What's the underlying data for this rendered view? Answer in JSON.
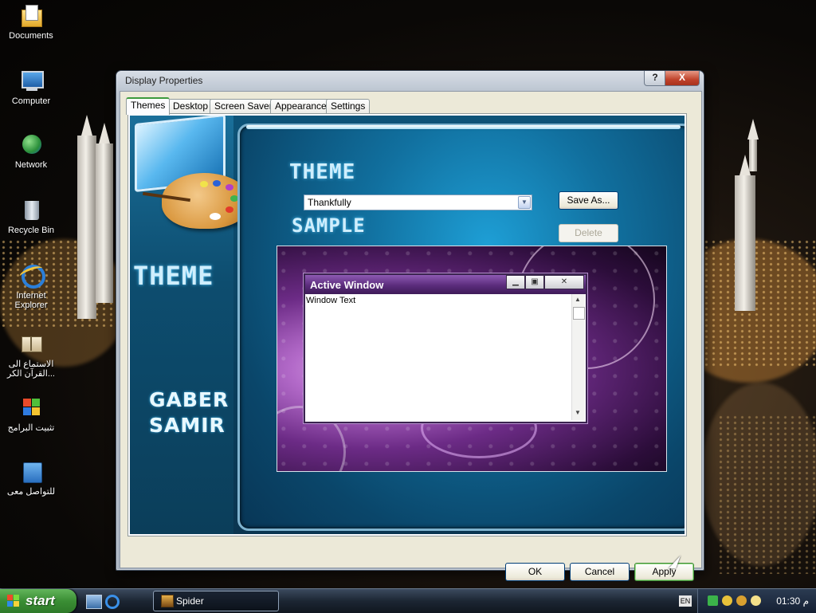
{
  "desktop": {
    "icons": [
      {
        "label": "Documents"
      },
      {
        "label": "Computer"
      },
      {
        "label": "Network"
      },
      {
        "label": "Recycle Bin"
      },
      {
        "label": "Internet Explorer"
      },
      {
        "label": "الاستماع الى القرآن الكر..."
      },
      {
        "label": "تثبيت البرامج"
      },
      {
        "label": "للتواصل معى"
      }
    ]
  },
  "dialog": {
    "title": "Display Properties",
    "help_label": "?",
    "close_label": "X",
    "tabs": [
      {
        "label": "Themes"
      },
      {
        "label": "Desktop"
      },
      {
        "label": "Screen Saver"
      },
      {
        "label": "Appearance"
      },
      {
        "label": "Settings"
      }
    ],
    "skin_text": {
      "theme_header": "THEME",
      "sample_header": "SAMPLE",
      "left_theme": "THEME",
      "author_line1": "GABER",
      "author_line2": "SAMIR"
    },
    "theme_select": {
      "value": "Thankfully"
    },
    "save_as_label": "Save As...",
    "delete_label": "Delete",
    "preview": {
      "window_title": "Active Window",
      "window_text": "Window Text"
    },
    "ok_label": "OK",
    "cancel_label": "Cancel",
    "apply_label": "Apply"
  },
  "taskbar": {
    "start_label": "start",
    "task_label": "Spider",
    "language": "EN",
    "clock": "01:30 م"
  }
}
